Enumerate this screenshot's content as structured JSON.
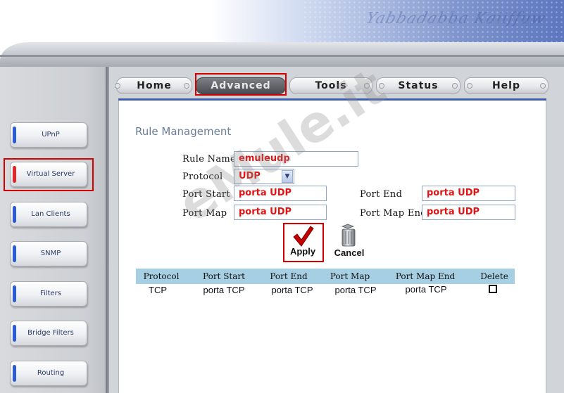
{
  "header": {
    "banner_script": "Yabbadabba Kaiiffuw"
  },
  "nav": {
    "tabs": [
      {
        "label": "Home",
        "active": false
      },
      {
        "label": "Advanced",
        "active": true
      },
      {
        "label": "Tools",
        "active": false
      },
      {
        "label": "Status",
        "active": false
      },
      {
        "label": "Help",
        "active": false
      }
    ]
  },
  "sidebar": {
    "items": [
      {
        "label": "UPnP",
        "active": false
      },
      {
        "label": "Virtual Server",
        "active": true
      },
      {
        "label": "Lan Clients",
        "active": false
      },
      {
        "label": "SNMP",
        "active": false
      },
      {
        "label": "Filters",
        "active": false
      },
      {
        "label": "Bridge Filters",
        "active": false
      },
      {
        "label": "Routing",
        "active": false
      }
    ]
  },
  "form": {
    "title": "Rule Management",
    "rule_name_label": "Rule Name",
    "rule_name_value": "emuleudp",
    "protocol_label": "Protocol",
    "protocol_value": "UDP",
    "port_start_label": "Port Start",
    "port_start_value": "porta UDP",
    "port_end_label": "Port End",
    "port_end_value": "porta UDP",
    "port_map_label": "Port Map",
    "port_map_value": "porta UDP",
    "port_map_end_label": "Port Map End",
    "port_map_end_value": "porta UDP"
  },
  "actions": {
    "apply_label": "Apply",
    "cancel_label": "Cancel"
  },
  "table": {
    "headers": [
      "Protocol",
      "Port Start",
      "Port End",
      "Port Map",
      "Port Map End",
      "Delete"
    ],
    "rows": [
      {
        "protocol": "TCP",
        "port_start": "porta TCP",
        "port_end": "porta TCP",
        "port_map": "porta TCP",
        "port_map_end": "porta TCP",
        "delete_checked": false
      }
    ]
  },
  "watermark": "eMule.it",
  "colors": {
    "highlight": "#d40000",
    "input_text": "#e01414",
    "table_header": "#a7cfe4",
    "panel_accent": "#3e5fae"
  }
}
